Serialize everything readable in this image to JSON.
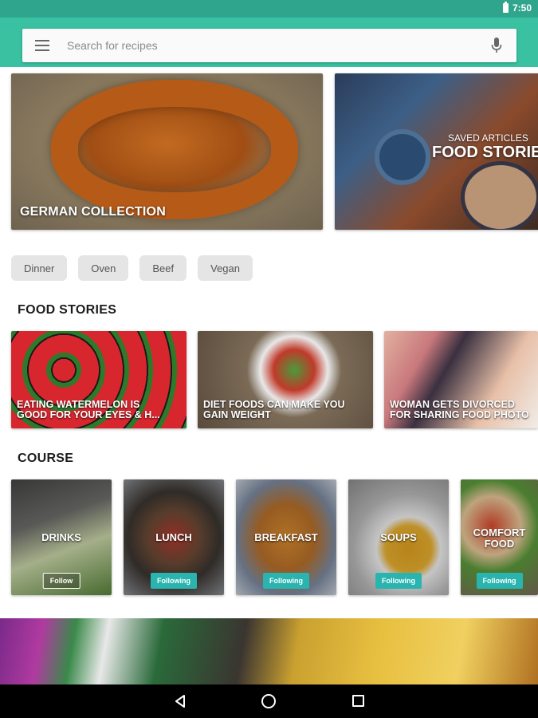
{
  "status_bar": {
    "time": "7:50",
    "battery_icon": "battery-icon"
  },
  "search": {
    "placeholder": "Search for recipes",
    "menu_icon": "menu-icon",
    "mic_icon": "mic-icon"
  },
  "hero": [
    {
      "title": "GERMAN COLLECTION"
    },
    {
      "subtitle": "SAVED ARTICLES",
      "title": "FOOD STORIES"
    }
  ],
  "chips": [
    "Dinner",
    "Oven",
    "Beef",
    "Vegan"
  ],
  "food_stories": {
    "heading": "FOOD STORIES",
    "items": [
      {
        "title": "EATING WATERMELON IS\nGOOD FOR YOUR EYES & H..."
      },
      {
        "title": "DIET FOODS CAN MAKE YOU\nGAIN WEIGHT"
      },
      {
        "title": "WOMAN GETS DIVORCED\nFOR SHARING FOOD PHOTO"
      }
    ]
  },
  "course": {
    "heading": "COURSE",
    "items": [
      {
        "label": "DRINKS",
        "button": "Follow"
      },
      {
        "label": "LUNCH",
        "button": "Following"
      },
      {
        "label": "BREAKFAST",
        "button": "Following"
      },
      {
        "label": "SOUPS",
        "button": "Following"
      },
      {
        "label": "COMFORT\nFOOD",
        "button": "Following"
      }
    ]
  },
  "colors": {
    "status_bar": "#2fa58e",
    "app_bar": "#39c1a1",
    "following_button": "#29b4b0"
  }
}
